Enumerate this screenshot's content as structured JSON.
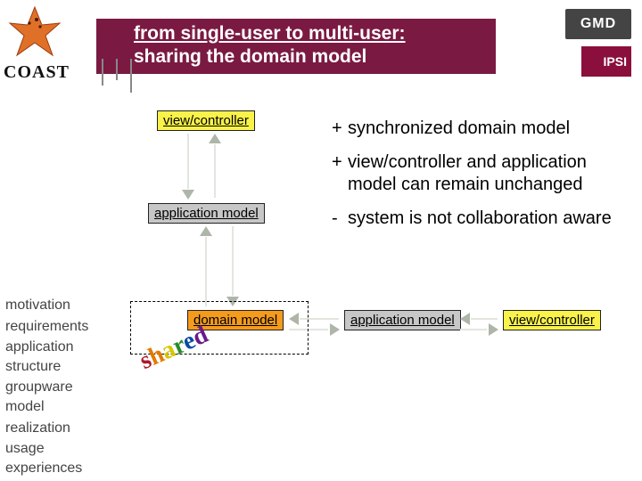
{
  "header": {
    "title_line1": "from single-user to multi-user:",
    "title_line2": "sharing the domain model",
    "logo_coast": "COAST",
    "logo_gmd": "GMD",
    "logo_ipsi": "IPSI"
  },
  "bullets": [
    {
      "mark": "+",
      "text": "synchronized domain model"
    },
    {
      "mark": "+",
      "text": "view/controller and application model can remain unchanged"
    },
    {
      "mark": "-",
      "text": "system is not collaboration aware"
    }
  ],
  "diagram": {
    "view_controller_top": "view/controller",
    "application_model_left": "application model",
    "domain_model": "domain model",
    "application_model_right": "application model",
    "view_controller_right": "view/controller",
    "shared_label_chars": [
      "s",
      "h",
      "a",
      "r",
      "e",
      "d"
    ]
  },
  "sidenav": {
    "items": [
      "motivation",
      "requirements",
      "application structure",
      "groupware model",
      "realization",
      "usage experiences"
    ]
  },
  "colors": {
    "brand": "#7a1a42",
    "yellow": "#f8f24a",
    "orange": "#f59b1c",
    "gray": "#c7c7c7"
  }
}
